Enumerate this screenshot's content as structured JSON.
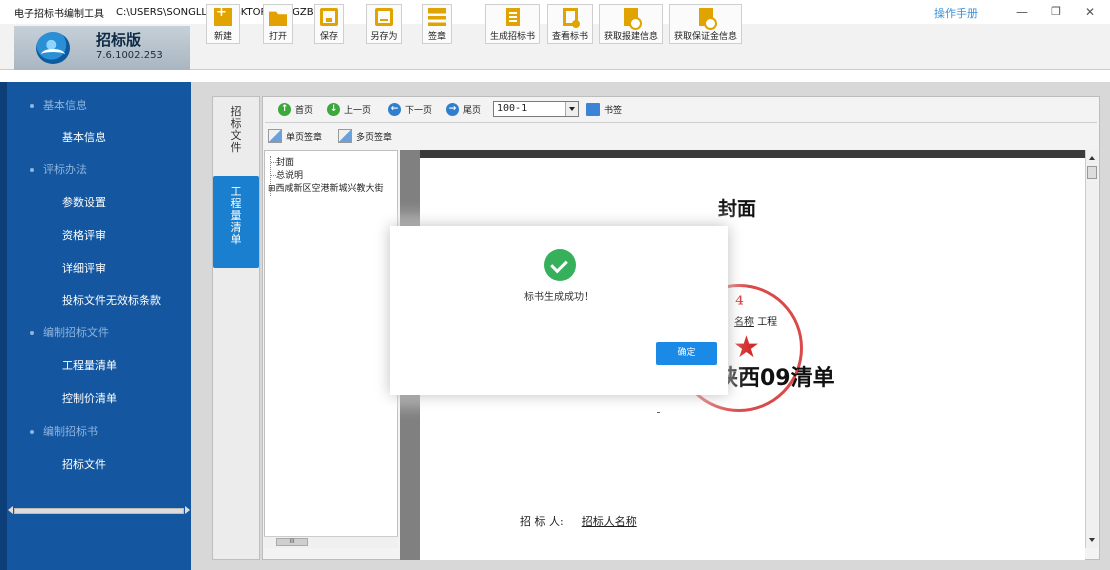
{
  "titlebar": {
    "app_title": "电子招标书编制工具",
    "file_path": "C:\\USERS\\SONGLL-A\\DESKTOP\\333.GZB7",
    "manual_link": "操作手册",
    "minimize": "—",
    "maximize": "❐",
    "close": "✕"
  },
  "brand": {
    "name": "招标版",
    "version": "7.6.1002.253"
  },
  "toolbar": {
    "buttons": [
      {
        "label": "新建",
        "icon": "new-file-icon"
      },
      {
        "label": "打开",
        "icon": "folder-open-icon"
      },
      {
        "label": "保存",
        "icon": "save-icon"
      },
      {
        "label": "另存为",
        "icon": "save-as-icon"
      },
      {
        "label": "签章",
        "icon": "stamp-icon"
      },
      {
        "label": "生成招标书",
        "icon": "generate-doc-icon"
      },
      {
        "label": "查看标书",
        "icon": "view-doc-icon"
      },
      {
        "label": "获取报建信息",
        "icon": "get-info-icon"
      },
      {
        "label": "获取保证金信息",
        "icon": "get-deposit-icon"
      }
    ]
  },
  "sidebar": {
    "sections": [
      {
        "title": "基本信息",
        "items": [
          "基本信息"
        ]
      },
      {
        "title": "评标办法",
        "items": [
          "参数设置",
          "资格评审",
          "详细评审",
          "投标文件无效标条款"
        ]
      },
      {
        "title": "编制招标文件",
        "items": [
          "工程量清单",
          "控制价清单"
        ]
      },
      {
        "title": "编制招标书",
        "items": [
          "招标文件"
        ]
      }
    ]
  },
  "vertical_tabs": [
    {
      "label": "招标文件",
      "active": false
    },
    {
      "label": "工程量清单",
      "active": true
    }
  ],
  "navigation": {
    "first": "首页",
    "prev": "上一页",
    "next": "下一页",
    "last": "尾页",
    "page_value": "100-1",
    "bookmark": "书签"
  },
  "signature": {
    "single": "单页签章",
    "multi": "多页签章"
  },
  "tree": {
    "items": [
      "封面",
      "总说明",
      "西咸新区空港新城兴教大街"
    ],
    "hscroll_glyph": "III"
  },
  "page": {
    "cover_title": "封面",
    "project_name": "名称",
    "project_suffix": "工程",
    "heading": "陕西09清单",
    "tenderer_label": "招 标 人:",
    "tenderer_value": "招标人名称"
  },
  "modal": {
    "message": "标书生成成功！",
    "ok_button": "确定"
  },
  "colors": {
    "sidebar_bg": "#1457a0",
    "accent_blue": "#1a7fce",
    "success_green": "#36b05a",
    "stamp_red": "#d42a2a",
    "toolbar_icon": "#e0a300"
  }
}
